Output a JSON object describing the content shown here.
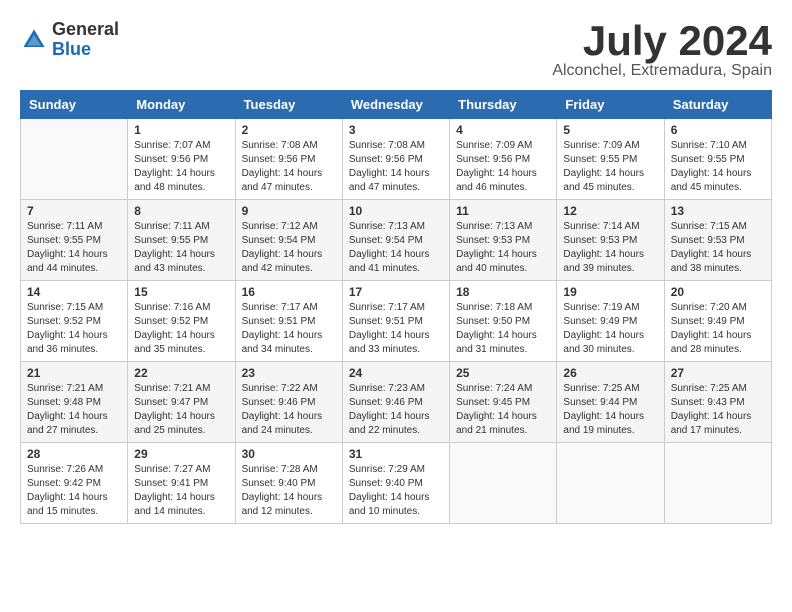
{
  "logo": {
    "general": "General",
    "blue": "Blue"
  },
  "title": {
    "month": "July 2024",
    "location": "Alconchel, Extremadura, Spain"
  },
  "headers": [
    "Sunday",
    "Monday",
    "Tuesday",
    "Wednesday",
    "Thursday",
    "Friday",
    "Saturday"
  ],
  "weeks": [
    {
      "shaded": false,
      "days": [
        {
          "date": "",
          "info": ""
        },
        {
          "date": "1",
          "info": "Sunrise: 7:07 AM\nSunset: 9:56 PM\nDaylight: 14 hours\nand 48 minutes."
        },
        {
          "date": "2",
          "info": "Sunrise: 7:08 AM\nSunset: 9:56 PM\nDaylight: 14 hours\nand 47 minutes."
        },
        {
          "date": "3",
          "info": "Sunrise: 7:08 AM\nSunset: 9:56 PM\nDaylight: 14 hours\nand 47 minutes."
        },
        {
          "date": "4",
          "info": "Sunrise: 7:09 AM\nSunset: 9:56 PM\nDaylight: 14 hours\nand 46 minutes."
        },
        {
          "date": "5",
          "info": "Sunrise: 7:09 AM\nSunset: 9:55 PM\nDaylight: 14 hours\nand 45 minutes."
        },
        {
          "date": "6",
          "info": "Sunrise: 7:10 AM\nSunset: 9:55 PM\nDaylight: 14 hours\nand 45 minutes."
        }
      ]
    },
    {
      "shaded": true,
      "days": [
        {
          "date": "7",
          "info": "Sunrise: 7:11 AM\nSunset: 9:55 PM\nDaylight: 14 hours\nand 44 minutes."
        },
        {
          "date": "8",
          "info": "Sunrise: 7:11 AM\nSunset: 9:55 PM\nDaylight: 14 hours\nand 43 minutes."
        },
        {
          "date": "9",
          "info": "Sunrise: 7:12 AM\nSunset: 9:54 PM\nDaylight: 14 hours\nand 42 minutes."
        },
        {
          "date": "10",
          "info": "Sunrise: 7:13 AM\nSunset: 9:54 PM\nDaylight: 14 hours\nand 41 minutes."
        },
        {
          "date": "11",
          "info": "Sunrise: 7:13 AM\nSunset: 9:53 PM\nDaylight: 14 hours\nand 40 minutes."
        },
        {
          "date": "12",
          "info": "Sunrise: 7:14 AM\nSunset: 9:53 PM\nDaylight: 14 hours\nand 39 minutes."
        },
        {
          "date": "13",
          "info": "Sunrise: 7:15 AM\nSunset: 9:53 PM\nDaylight: 14 hours\nand 38 minutes."
        }
      ]
    },
    {
      "shaded": false,
      "days": [
        {
          "date": "14",
          "info": "Sunrise: 7:15 AM\nSunset: 9:52 PM\nDaylight: 14 hours\nand 36 minutes."
        },
        {
          "date": "15",
          "info": "Sunrise: 7:16 AM\nSunset: 9:52 PM\nDaylight: 14 hours\nand 35 minutes."
        },
        {
          "date": "16",
          "info": "Sunrise: 7:17 AM\nSunset: 9:51 PM\nDaylight: 14 hours\nand 34 minutes."
        },
        {
          "date": "17",
          "info": "Sunrise: 7:17 AM\nSunset: 9:51 PM\nDaylight: 14 hours\nand 33 minutes."
        },
        {
          "date": "18",
          "info": "Sunrise: 7:18 AM\nSunset: 9:50 PM\nDaylight: 14 hours\nand 31 minutes."
        },
        {
          "date": "19",
          "info": "Sunrise: 7:19 AM\nSunset: 9:49 PM\nDaylight: 14 hours\nand 30 minutes."
        },
        {
          "date": "20",
          "info": "Sunrise: 7:20 AM\nSunset: 9:49 PM\nDaylight: 14 hours\nand 28 minutes."
        }
      ]
    },
    {
      "shaded": true,
      "days": [
        {
          "date": "21",
          "info": "Sunrise: 7:21 AM\nSunset: 9:48 PM\nDaylight: 14 hours\nand 27 minutes."
        },
        {
          "date": "22",
          "info": "Sunrise: 7:21 AM\nSunset: 9:47 PM\nDaylight: 14 hours\nand 25 minutes."
        },
        {
          "date": "23",
          "info": "Sunrise: 7:22 AM\nSunset: 9:46 PM\nDaylight: 14 hours\nand 24 minutes."
        },
        {
          "date": "24",
          "info": "Sunrise: 7:23 AM\nSunset: 9:46 PM\nDaylight: 14 hours\nand 22 minutes."
        },
        {
          "date": "25",
          "info": "Sunrise: 7:24 AM\nSunset: 9:45 PM\nDaylight: 14 hours\nand 21 minutes."
        },
        {
          "date": "26",
          "info": "Sunrise: 7:25 AM\nSunset: 9:44 PM\nDaylight: 14 hours\nand 19 minutes."
        },
        {
          "date": "27",
          "info": "Sunrise: 7:25 AM\nSunset: 9:43 PM\nDaylight: 14 hours\nand 17 minutes."
        }
      ]
    },
    {
      "shaded": false,
      "days": [
        {
          "date": "28",
          "info": "Sunrise: 7:26 AM\nSunset: 9:42 PM\nDaylight: 14 hours\nand 15 minutes."
        },
        {
          "date": "29",
          "info": "Sunrise: 7:27 AM\nSunset: 9:41 PM\nDaylight: 14 hours\nand 14 minutes."
        },
        {
          "date": "30",
          "info": "Sunrise: 7:28 AM\nSunset: 9:40 PM\nDaylight: 14 hours\nand 12 minutes."
        },
        {
          "date": "31",
          "info": "Sunrise: 7:29 AM\nSunset: 9:40 PM\nDaylight: 14 hours\nand 10 minutes."
        },
        {
          "date": "",
          "info": ""
        },
        {
          "date": "",
          "info": ""
        },
        {
          "date": "",
          "info": ""
        }
      ]
    }
  ]
}
